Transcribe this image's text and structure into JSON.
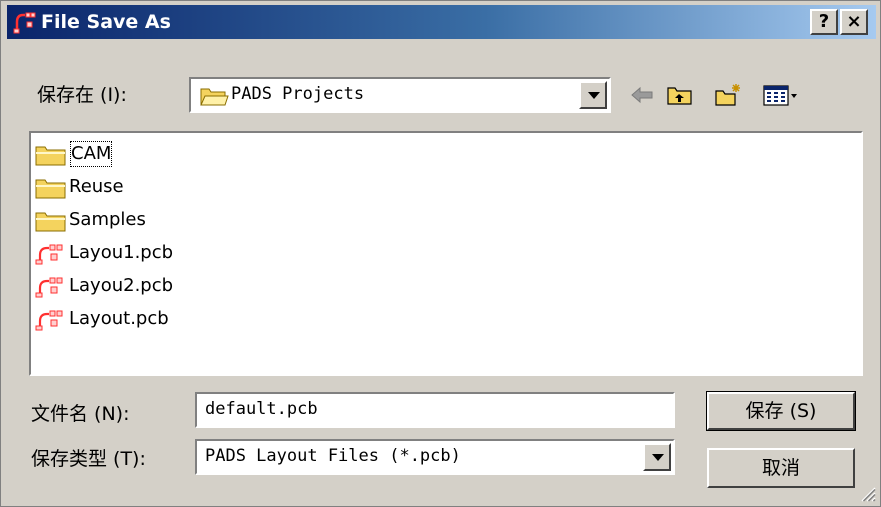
{
  "window": {
    "title": "File Save As",
    "help_button": "?",
    "close_button": "×"
  },
  "save_in": {
    "label": "保存在 (I):",
    "value": "PADS Projects"
  },
  "toolbar": {
    "icons": [
      "back-arrow-icon",
      "up-one-level-icon",
      "new-folder-icon",
      "view-menu-icon"
    ]
  },
  "files": [
    {
      "name": "CAM",
      "type": "folder"
    },
    {
      "name": "Reuse",
      "type": "folder"
    },
    {
      "name": "Samples",
      "type": "folder"
    },
    {
      "name": "Layou1.pcb",
      "type": "pcb"
    },
    {
      "name": "Layou2.pcb",
      "type": "pcb"
    },
    {
      "name": "Layout.pcb",
      "type": "pcb"
    }
  ],
  "file_name": {
    "label": "文件名 (N):",
    "value": "default.pcb"
  },
  "save_type": {
    "label": "保存类型 (T):",
    "value": "PADS Layout Files (*.pcb)"
  },
  "buttons": {
    "save": "保存 (S)",
    "cancel": "取消"
  },
  "colors": {
    "title_start": "#0a246a",
    "title_end": "#a6caf0",
    "face": "#d4d0c8",
    "folder": "#f4d35e"
  }
}
